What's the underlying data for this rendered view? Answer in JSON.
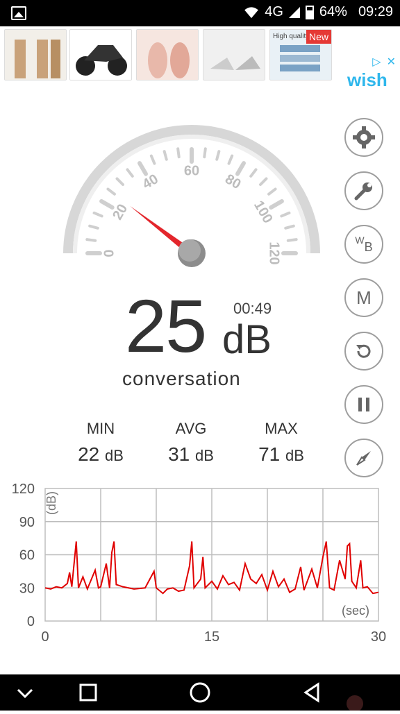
{
  "status": {
    "network": "4G",
    "battery": "64%",
    "time": "09:29"
  },
  "ad": {
    "badge": "New",
    "brand": "wish",
    "thumb5_label": "High quality"
  },
  "gauge": {
    "ticks": [
      "0",
      "20",
      "40",
      "60",
      "80",
      "100",
      "120"
    ],
    "value": 25,
    "max": 120
  },
  "reading": {
    "value": "25",
    "unit": "dB",
    "timer": "00:49",
    "description": "conversation"
  },
  "stats": {
    "min_label": "MIN",
    "min_value": "22",
    "min_unit": "dB",
    "avg_label": "AVG",
    "avg_value": "31",
    "avg_unit": "dB",
    "max_label": "MAX",
    "max_value": "71",
    "max_unit": "dB"
  },
  "chart_data": {
    "type": "line",
    "ylabel": "(dB)",
    "xlabel": "(sec)",
    "ylim": [
      0,
      120
    ],
    "xlim": [
      0,
      30
    ],
    "yticks": [
      "120",
      "90",
      "60",
      "30",
      "0"
    ],
    "xticks": [
      "0",
      "15",
      "30"
    ],
    "series": [
      {
        "values": [
          [
            0,
            30
          ],
          [
            0.5,
            29
          ],
          [
            1,
            31
          ],
          [
            1.5,
            30
          ],
          [
            2,
            34
          ],
          [
            2.2,
            44
          ],
          [
            2.4,
            31
          ],
          [
            2.8,
            72
          ],
          [
            3,
            30
          ],
          [
            3.4,
            40
          ],
          [
            3.8,
            29
          ],
          [
            4.5,
            46
          ],
          [
            4.8,
            30
          ],
          [
            5,
            31
          ],
          [
            5.5,
            52
          ],
          [
            5.8,
            30
          ],
          [
            6,
            62
          ],
          [
            6.2,
            72
          ],
          [
            6.4,
            33
          ],
          [
            7,
            31
          ],
          [
            8,
            29
          ],
          [
            9,
            30
          ],
          [
            9.8,
            45
          ],
          [
            10,
            30
          ],
          [
            10.6,
            25
          ],
          [
            11,
            29
          ],
          [
            11.5,
            30
          ],
          [
            12,
            27
          ],
          [
            12.5,
            28
          ],
          [
            13,
            50
          ],
          [
            13.2,
            72
          ],
          [
            13.4,
            30
          ],
          [
            14,
            38
          ],
          [
            14.2,
            58
          ],
          [
            14.4,
            30
          ],
          [
            15,
            36
          ],
          [
            15.5,
            29
          ],
          [
            16,
            41
          ],
          [
            16.5,
            33
          ],
          [
            17,
            35
          ],
          [
            17.5,
            28
          ],
          [
            18,
            52
          ],
          [
            18.5,
            38
          ],
          [
            19,
            34
          ],
          [
            19.5,
            42
          ],
          [
            20,
            28
          ],
          [
            20.5,
            45
          ],
          [
            21,
            31
          ],
          [
            21.5,
            38
          ],
          [
            22,
            26
          ],
          [
            22.5,
            29
          ],
          [
            23,
            49
          ],
          [
            23.3,
            28
          ],
          [
            24,
            47
          ],
          [
            24.5,
            30
          ],
          [
            25,
            58
          ],
          [
            25.3,
            72
          ],
          [
            25.6,
            30
          ],
          [
            26,
            28
          ],
          [
            26.5,
            55
          ],
          [
            27,
            38
          ],
          [
            27.2,
            68
          ],
          [
            27.4,
            70
          ],
          [
            27.6,
            36
          ],
          [
            28,
            30
          ],
          [
            28.4,
            55
          ],
          [
            28.6,
            30
          ],
          [
            29,
            31
          ],
          [
            29.5,
            25
          ],
          [
            30,
            26
          ]
        ]
      }
    ]
  }
}
